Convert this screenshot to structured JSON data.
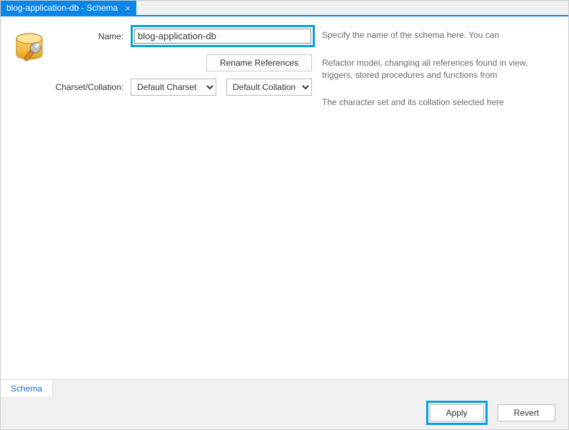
{
  "tab": {
    "title": "blog-application-db - Schema"
  },
  "labels": {
    "name": "Name:",
    "charset": "Charset/Collation:"
  },
  "fields": {
    "name_value": "blog-application-db",
    "rename_label": "Rename References",
    "charset_option": "Default Charset",
    "collation_option": "Default Collation"
  },
  "descriptions": {
    "name": "Specify the name of the schema here. You can",
    "rename": "Refactor model, changing all references found in view, triggers, stored procedures and functions from",
    "charset": "The character set and its collation selected here"
  },
  "bottom_tab": "Schema",
  "footer": {
    "apply": "Apply",
    "revert": "Revert"
  }
}
